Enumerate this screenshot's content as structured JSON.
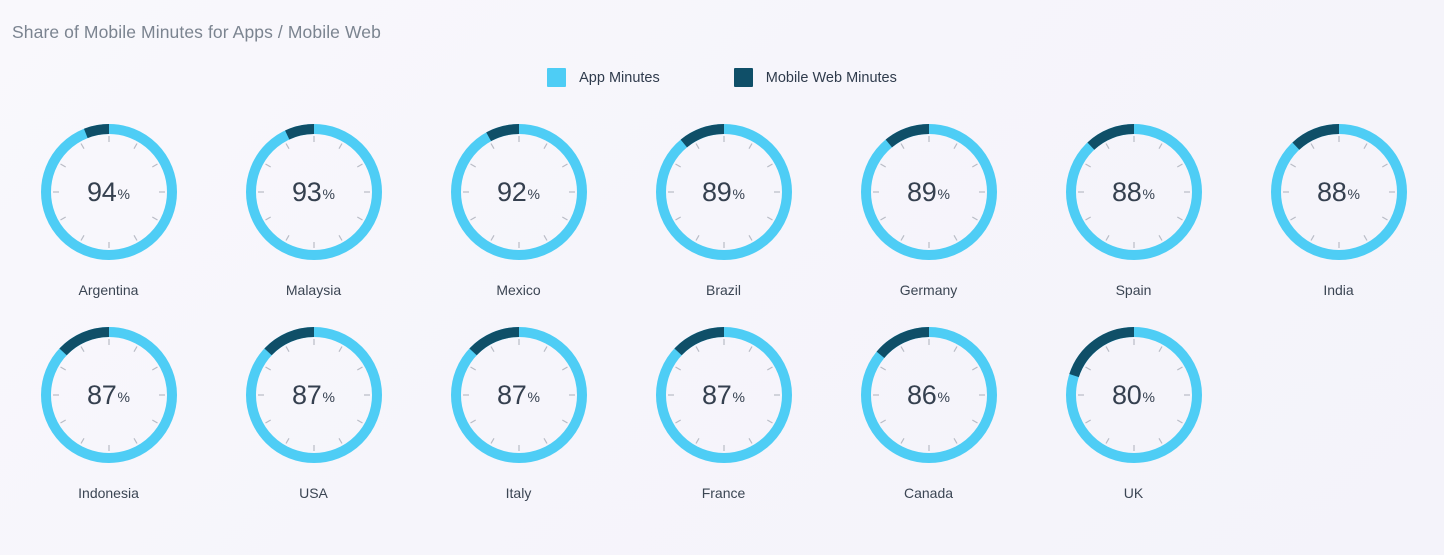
{
  "header": {
    "title": "Share of Mobile Minutes for Apps / Mobile Web"
  },
  "legend": {
    "items": [
      {
        "label": "App Minutes",
        "color": "#4ecdf5",
        "icon": "legend-swatch-app-minutes"
      },
      {
        "label": "Mobile Web Minutes",
        "color": "#0f4f68",
        "icon": "legend-swatch-mobile-web-minutes"
      }
    ]
  },
  "colors": {
    "app_minutes": "#4ecdf5",
    "mobile_web_minutes": "#0f4f68",
    "background": "#f7f6fb",
    "tick": "#b9bcc6",
    "value_text": "#35404f",
    "label_text": "#3b4553",
    "title_text": "#7b8490"
  },
  "gauges": {
    "suffix": "%",
    "tick_count": 12,
    "rows": [
      [
        {
          "country": "Argentina",
          "app_pct": 94,
          "web_pct": 6
        },
        {
          "country": "Malaysia",
          "app_pct": 93,
          "web_pct": 7
        },
        {
          "country": "Mexico",
          "app_pct": 92,
          "web_pct": 8
        },
        {
          "country": "Brazil",
          "app_pct": 89,
          "web_pct": 11
        },
        {
          "country": "Germany",
          "app_pct": 89,
          "web_pct": 11
        },
        {
          "country": "Spain",
          "app_pct": 88,
          "web_pct": 12
        },
        {
          "country": "India",
          "app_pct": 88,
          "web_pct": 12
        }
      ],
      [
        {
          "country": "Indonesia",
          "app_pct": 87,
          "web_pct": 13
        },
        {
          "country": "USA",
          "app_pct": 87,
          "web_pct": 13
        },
        {
          "country": "Italy",
          "app_pct": 87,
          "web_pct": 13
        },
        {
          "country": "France",
          "app_pct": 87,
          "web_pct": 13
        },
        {
          "country": "Canada",
          "app_pct": 86,
          "web_pct": 14
        },
        {
          "country": "UK",
          "app_pct": 80,
          "web_pct": 20
        }
      ]
    ]
  },
  "chart_data": {
    "type": "pie",
    "title": "Share of Mobile Minutes for Apps / Mobile Web",
    "subtitle": "",
    "xlabel": "",
    "ylabel": "",
    "unit": "%",
    "legend_position": "top-center",
    "grid": false,
    "categories": [
      "Argentina",
      "Malaysia",
      "Mexico",
      "Brazil",
      "Germany",
      "Spain",
      "India",
      "Indonesia",
      "USA",
      "Italy",
      "France",
      "Canada",
      "UK"
    ],
    "series": [
      {
        "name": "App Minutes",
        "color": "#4ecdf5",
        "values": [
          94,
          93,
          92,
          89,
          89,
          88,
          88,
          87,
          87,
          87,
          87,
          86,
          80
        ]
      },
      {
        "name": "Mobile Web Minutes",
        "color": "#0f4f68",
        "values": [
          6,
          7,
          8,
          11,
          11,
          12,
          12,
          13,
          13,
          13,
          13,
          14,
          20
        ]
      }
    ],
    "ylim": [
      0,
      100
    ],
    "annotations": []
  }
}
